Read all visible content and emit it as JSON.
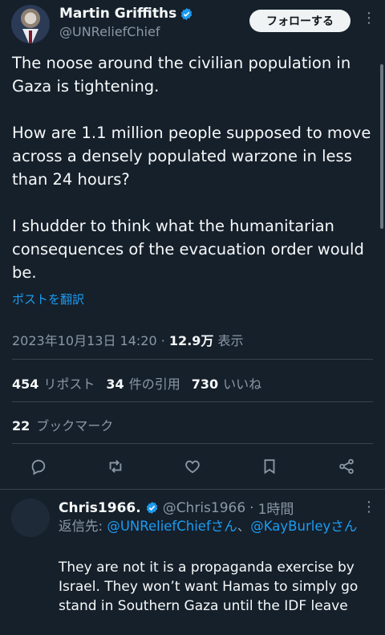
{
  "author": {
    "name": "Martin Griffiths",
    "handle": "@UNReliefChief",
    "follow_label": "フォローする",
    "verified_color": "#1d9bf0"
  },
  "tweet": {
    "paragraphs": [
      "The noose around the civilian population in Gaza is tightening.",
      "How are 1.1 million people supposed to move across a densely populated warzone in less than 24 hours?",
      "I shudder to think what the humanitarian consequences of the evacuation order would be."
    ],
    "translate_label": "ポストを翻訳",
    "timestamp": "2023年10月13日 14:20",
    "separator": "·",
    "views_count": "12.9万",
    "views_label": "表示"
  },
  "stats": {
    "reposts_count": "454",
    "reposts_label": "リポスト",
    "quotes_count": "34",
    "quotes_label": "件の引用",
    "likes_count": "730",
    "likes_label": "いいね",
    "bookmarks_count": "22",
    "bookmarks_label": "ブックマーク"
  },
  "actions": [
    "reply-icon",
    "repost-icon",
    "like-icon",
    "bookmark-icon",
    "share-icon"
  ],
  "reply": {
    "name": "Chris1966.",
    "handle": "@Chris1966",
    "separator": "·",
    "time": "1時間",
    "reply_prefix": "返信先:",
    "mention_1": "@UNReliefChiefさん",
    "joiner": "、",
    "mention_2": "@KayBurleyさん",
    "text": "They are not it is a propaganda exercise by Israel.  They won’t want Hamas to simply go stand in Southern Gaza until the IDF leave"
  },
  "colors": {
    "background": "#15202b",
    "text": "#f7f9f9",
    "muted": "#8b98a5",
    "link": "#1d9bf0",
    "divider": "#38444d"
  }
}
